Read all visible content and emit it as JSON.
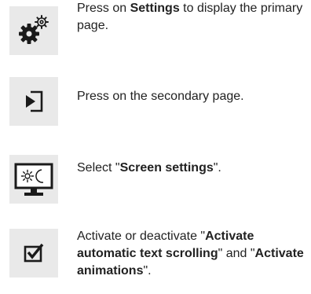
{
  "steps": [
    {
      "icon": "settings-gears-icon",
      "text_parts": [
        {
          "t": "Press on ",
          "b": false
        },
        {
          "t": "Settings",
          "b": true
        },
        {
          "t": " to display the primary page.",
          "b": false
        }
      ]
    },
    {
      "icon": "enter-page-icon",
      "text_parts": [
        {
          "t": "Press on the secondary page.",
          "b": false
        }
      ]
    },
    {
      "icon": "screen-day-night-icon",
      "text_parts": [
        {
          "t": "Select \"",
          "b": false
        },
        {
          "t": "Screen settings",
          "b": true
        },
        {
          "t": "\".",
          "b": false
        }
      ]
    },
    {
      "icon": "checkbox-checked-icon",
      "text_parts": [
        {
          "t": "Activate or deactivate \"",
          "b": false
        },
        {
          "t": "Activate automatic text scrolling",
          "b": true
        },
        {
          "t": "\" and \"",
          "b": false
        },
        {
          "t": "Activate animations",
          "b": true
        },
        {
          "t": "\".",
          "b": false
        }
      ]
    }
  ]
}
